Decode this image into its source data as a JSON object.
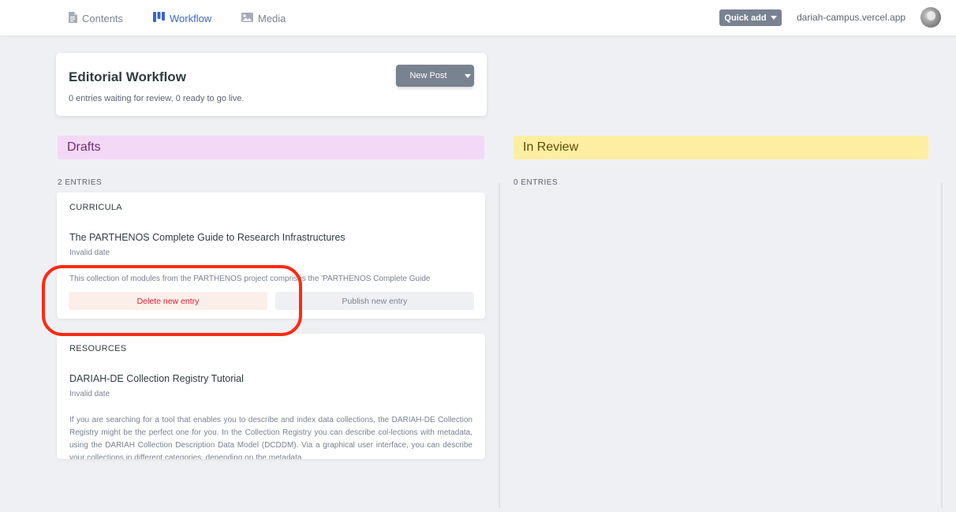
{
  "nav": {
    "contents_label": "Contents",
    "workflow_label": "Workflow",
    "media_label": "Media",
    "quick_add_label": "Quick add",
    "site_url": "dariah-campus.vercel.app"
  },
  "header": {
    "title": "Editorial Workflow",
    "status_text": "0 entries waiting for review, 0 ready to go live.",
    "new_post_label": "New Post"
  },
  "columns": {
    "drafts": {
      "title": "Drafts",
      "count_label": "2 ENTRIES"
    },
    "review": {
      "title": "In Review",
      "count_label": "0 ENTRIES"
    }
  },
  "entries": [
    {
      "collection": "CURRICULA",
      "title": "The PARTHENOS Complete Guide to Research Infrastructures",
      "date": "Invalid date",
      "description": "This collection of modules from the PARTHENOS project comprises the 'PARTHENOS Complete Guide",
      "delete_label": "Delete new entry",
      "publish_label": "Publish new entry"
    },
    {
      "collection": "RESOURCES",
      "title": "DARIAH-DE Collection Registry Tutorial",
      "date": "Invalid date",
      "description": "If you are searching for a tool that enables you to describe and index data collections, the DARIAH-DE Collection Registry might be the perfect one for you. In the Collection Registry you can describe col-lections with metadata, using the DARIAH Collection Description Data Model (DCDDM). Via a graphical user interface, you can describe your collections in different categories, depending on the metadata"
    }
  ],
  "colors": {
    "accent": "#3a69c7",
    "drafts_bg": "#f4d9f6",
    "review_bg": "#feeea1",
    "delete_text": "#e61b33",
    "annotation": "#fd2b12"
  },
  "icons": {
    "contents": "document-icon",
    "workflow": "kanban-icon",
    "media": "image-icon"
  }
}
